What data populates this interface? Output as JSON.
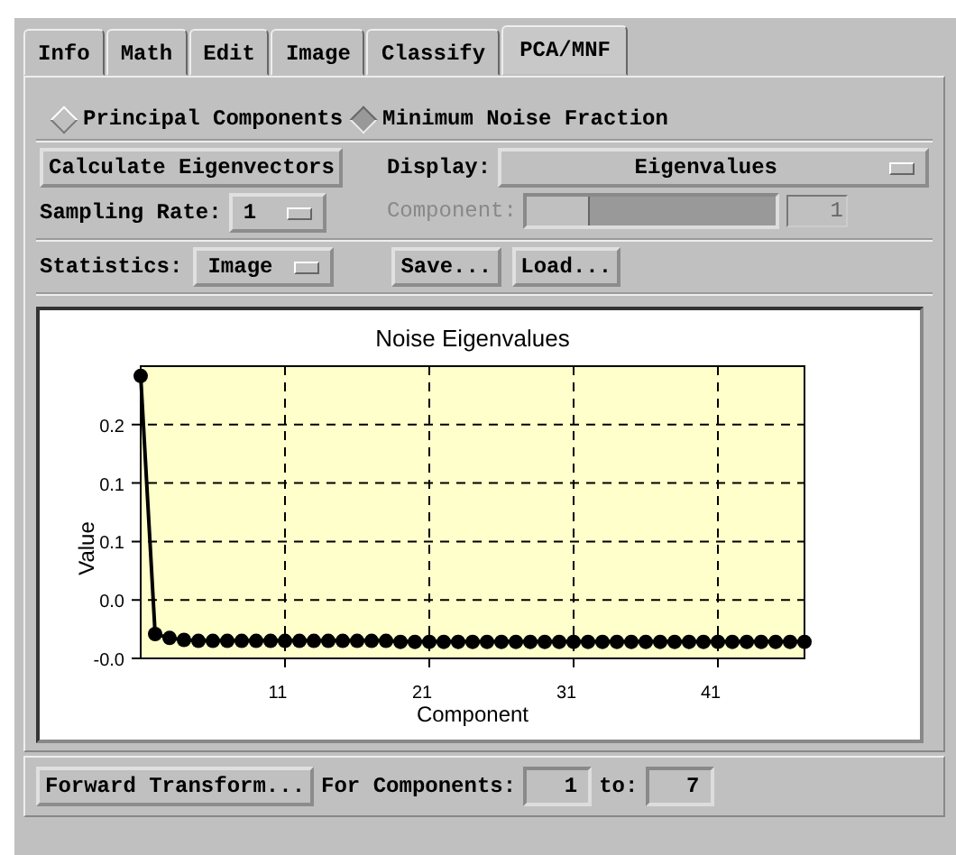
{
  "tabs": [
    {
      "label": "Info",
      "selected": false
    },
    {
      "label": "Math",
      "selected": false
    },
    {
      "label": "Edit",
      "selected": false
    },
    {
      "label": "Image",
      "selected": false
    },
    {
      "label": "Classify",
      "selected": false
    },
    {
      "label": "PCA/MNF",
      "selected": true
    }
  ],
  "transform_type": [
    {
      "label": "Principal Components",
      "selected": false
    },
    {
      "label": "Minimum Noise Fraction",
      "selected": true
    }
  ],
  "calculate_button": "Calculate Eigenvectors",
  "display": {
    "label": "Display:",
    "value": "Eigenvalues"
  },
  "sampling_rate": {
    "label": "Sampling Rate:",
    "value": "1"
  },
  "component_slider": {
    "label": "Component:",
    "disabled": true,
    "level": 0,
    "reading": "1"
  },
  "statistics": {
    "label": "Statistics:",
    "value": "Image"
  },
  "file_buttons": [
    "Save...",
    "Load..."
  ],
  "chart": {
    "chart_data": {
      "type": "line",
      "title": "Noise Eigenvalues",
      "xlabel": "Component",
      "ylabel": "Value",
      "x": [
        1,
        2,
        3,
        4,
        5,
        6,
        7,
        8,
        9,
        10,
        11,
        12,
        13,
        14,
        15,
        16,
        17,
        18,
        19,
        20,
        21,
        22,
        23,
        24,
        25,
        26,
        27,
        28,
        29,
        30,
        31,
        32,
        33,
        34,
        35,
        36,
        37,
        38,
        39,
        40,
        41,
        42,
        43,
        44,
        45,
        46,
        47
      ],
      "grid": true,
      "series": [
        {
          "color": "#000000",
          "marker": "circle",
          "values": [
            0.25,
            -0.015,
            -0.019,
            -0.021,
            -0.022,
            -0.022,
            -0.022,
            -0.022,
            -0.022,
            -0.022,
            -0.022,
            -0.022,
            -0.022,
            -0.022,
            -0.022,
            -0.022,
            -0.022,
            -0.022,
            -0.023,
            -0.023,
            -0.023,
            -0.023,
            -0.023,
            -0.023,
            -0.023,
            -0.023,
            -0.023,
            -0.023,
            -0.023,
            -0.023,
            -0.023,
            -0.023,
            -0.023,
            -0.023,
            -0.023,
            -0.023,
            -0.023,
            -0.023,
            -0.023,
            -0.023,
            -0.023,
            -0.023,
            -0.023,
            -0.023,
            -0.023,
            -0.023,
            -0.023
          ]
        }
      ],
      "xlim": [
        1,
        47
      ],
      "ylim": [
        -0.04,
        0.26
      ],
      "xticks": [
        11,
        21,
        31,
        41
      ],
      "yticks": [
        {
          "value": -0.04,
          "label": "-0.0"
        },
        {
          "value": 0.02,
          "label": "0.0"
        },
        {
          "value": 0.08,
          "label": "0.1"
        },
        {
          "value": 0.14,
          "label": "0.1"
        },
        {
          "value": 0.2,
          "label": "0.2"
        }
      ]
    }
  },
  "forward_button": "Forward Transform...",
  "components_range": {
    "label": "For Components:",
    "from": "1",
    "to_label": "to:",
    "to": "7"
  }
}
